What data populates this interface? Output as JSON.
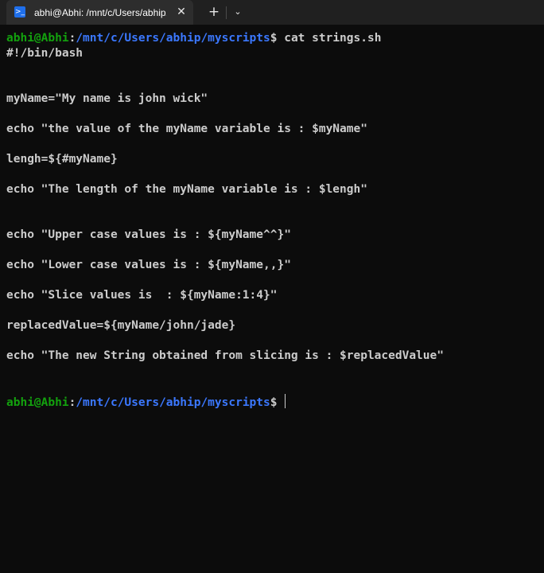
{
  "tab": {
    "title": "abhi@Abhi: /mnt/c/Users/abhip/myscripts",
    "icon": "powershell-terminal-icon",
    "close_glyph": "✕"
  },
  "toolbar": {
    "new_tab_glyph": "+",
    "dropdown_glyph": "⌄"
  },
  "prompt": {
    "user_host": "abhi@Abhi",
    "colon": ":",
    "path": "/mnt/c/Users/abhip/myscripts",
    "dollar": "$"
  },
  "command": " cat strings.sh",
  "output_lines": [
    "#!/bin/bash",
    "myName=\"My name is john wick\"",
    "echo \"the value of the myName variable is : $myName\"",
    "lengh=${#myName}",
    "echo \"The length of the myName variable is : $lengh\"",
    "echo \"Upper case values is : ${myName^^}\"",
    "echo \"Lower case values is : ${myName,,}\"",
    "echo \"Slice values is  : ${myName:1:4}\"",
    "replacedValue=${myName/john/jade}",
    "echo \"The new String obtained from slicing is : $replacedValue\""
  ],
  "colors": {
    "background": "#0c0c0c",
    "user": "#13a10e",
    "path": "#3b78ff",
    "text": "#cccccc"
  }
}
